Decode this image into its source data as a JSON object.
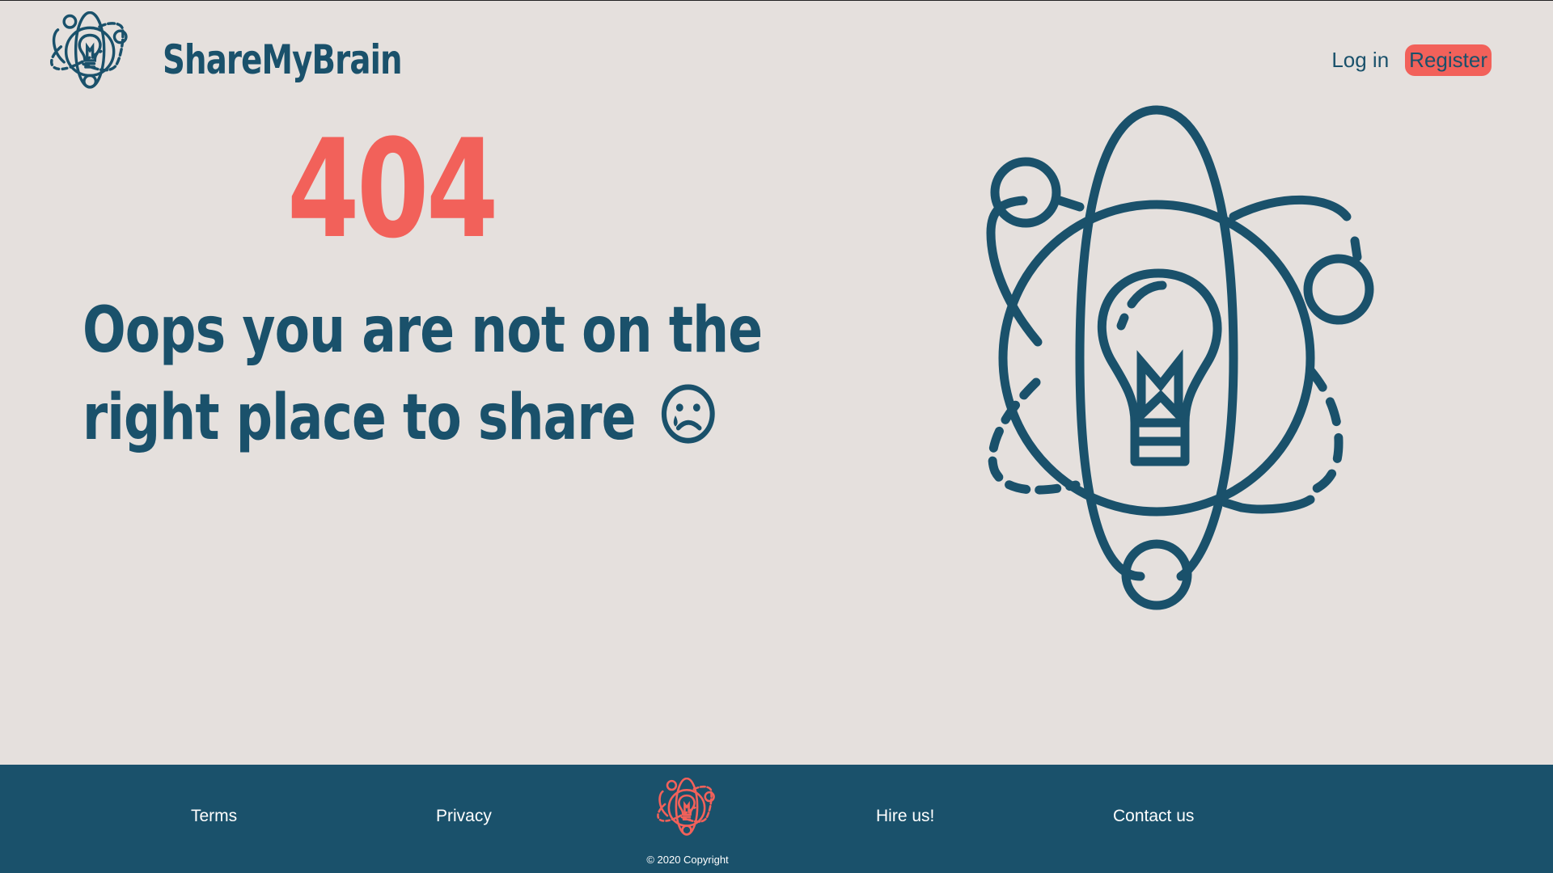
{
  "header": {
    "brand_name": "ShareMyBrain",
    "logo_icon": "atom-lightbulb-icon",
    "nav": {
      "login_label": "Log in",
      "register_label": "Register"
    }
  },
  "main": {
    "error_code": "404",
    "message_line1": "Oops you are not on the",
    "message_line2": "right place to share",
    "message_icon": "sad-face-icon",
    "illustration_icon": "atom-lightbulb-icon"
  },
  "footer": {
    "links": [
      "Terms",
      "Privacy",
      "Hire us!",
      "Contact us"
    ],
    "copyright": "© 2020 Copyright",
    "logo_icon": "atom-lightbulb-icon"
  },
  "colors": {
    "background": "#e5e0dd",
    "primary": "#1a516b",
    "accent": "#f2615a",
    "footer_text": "#ffffff"
  }
}
